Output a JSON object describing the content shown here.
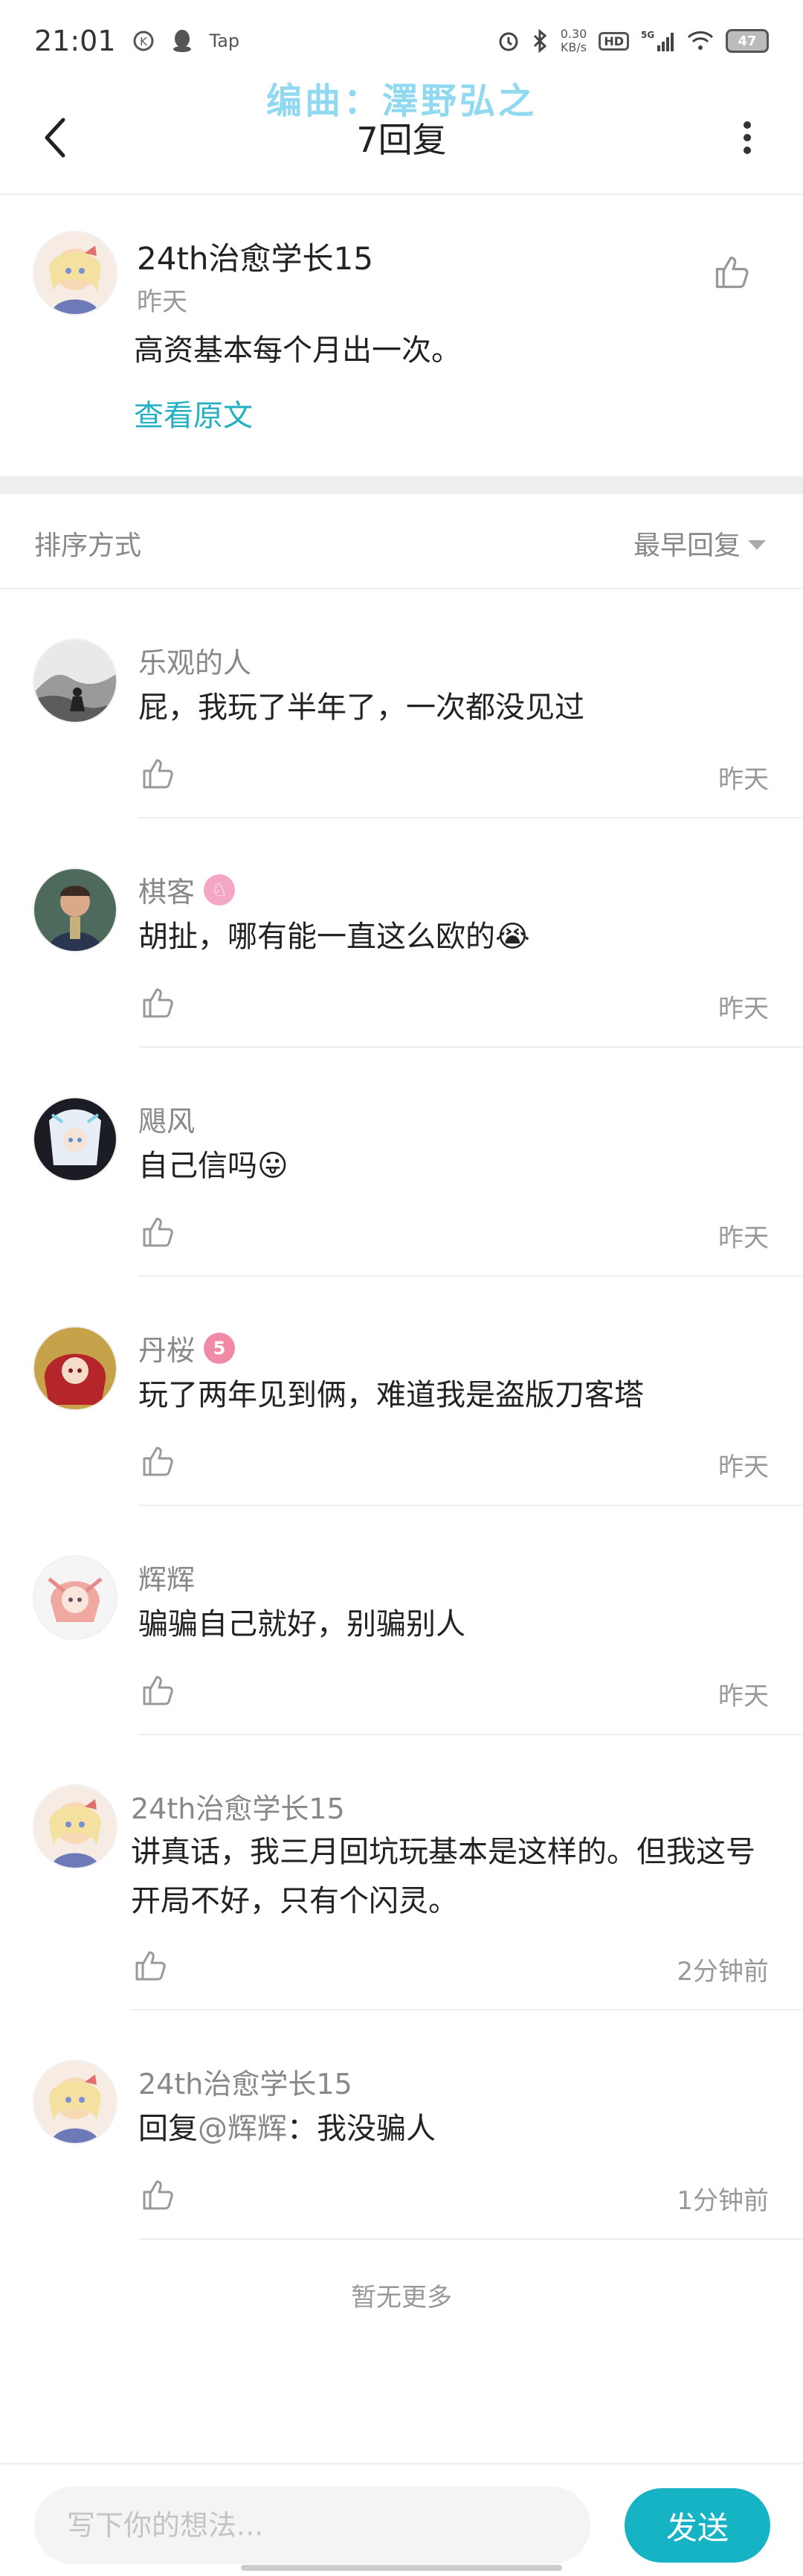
{
  "status_bar": {
    "time": "21:01",
    "app_tag": "Tap",
    "net_speed_top": "0.30",
    "net_speed_bottom": "KB/s",
    "hd": "HD",
    "network": "5G",
    "battery": "47"
  },
  "watermark": "编曲：澤野弘之",
  "header": {
    "title": "7回复"
  },
  "post": {
    "username": "24th治愈学长15",
    "time": "昨天",
    "text": "高资基本每个月出一次。",
    "view_original": "查看原文"
  },
  "sort": {
    "label": "排序方式",
    "value": "最早回复"
  },
  "replies": [
    {
      "username": "乐观的人",
      "badge": "",
      "text": "屁，我玩了半年了，一次都没见过",
      "time": "昨天"
    },
    {
      "username": "棋客",
      "badge": "♘",
      "text": "胡扯，哪有能一直这么欧的😭",
      "time": "昨天"
    },
    {
      "username": "飓风",
      "badge": "",
      "text": "自己信吗😛",
      "time": "昨天"
    },
    {
      "username": "丹桜",
      "badge": "5",
      "text": "玩了两年见到俩，难道我是盗版刀客塔",
      "time": "昨天"
    },
    {
      "username": "辉辉",
      "badge": "",
      "text": "骗骗自己就好，别骗别人",
      "time": "昨天"
    },
    {
      "username": "24th治愈学长15",
      "badge": "",
      "text": "讲真话，我三月回坑玩基本是这样的。但我这号开局不好，只有个闪灵。",
      "time": "2分钟前"
    },
    {
      "username": "24th治愈学长15",
      "badge": "",
      "reply_prefix": "回复",
      "mention": "@辉辉",
      "text": "：我没骗人",
      "time": "1分钟前"
    }
  ],
  "no_more": "暂无更多",
  "composer": {
    "placeholder": "写下你的想法...",
    "send": "发送"
  },
  "colors": {
    "accent": "#16b3c4",
    "link": "#22b0c2",
    "watermark": "#7ed3ee"
  }
}
